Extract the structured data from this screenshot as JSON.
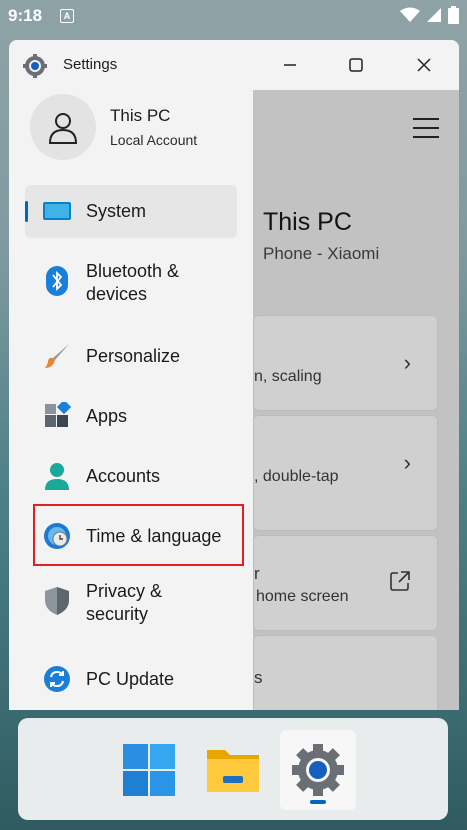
{
  "status_bar": {
    "time": "9:18",
    "badge": "A"
  },
  "window": {
    "title": "Settings"
  },
  "profile": {
    "name": "This PC",
    "account_type": "Local Account"
  },
  "nav": {
    "items": [
      {
        "label": "System",
        "icon": "monitor-icon"
      },
      {
        "label1": "Bluetooth &",
        "label2": "devices",
        "icon": "bluetooth-icon"
      },
      {
        "label": "Personalize",
        "icon": "paintbrush-icon"
      },
      {
        "label": "Apps",
        "icon": "apps-icon"
      },
      {
        "label": "Accounts",
        "icon": "person-icon"
      },
      {
        "label": "Time & language",
        "icon": "globe-clock-icon"
      },
      {
        "label1": "Privacy &",
        "label2": "security",
        "icon": "shield-icon"
      },
      {
        "label": "PC Update",
        "icon": "sync-icon"
      }
    ],
    "active_index": 0,
    "highlighted_index": 5
  },
  "content": {
    "device_name": "This PC",
    "device_subtitle": "Phone - Xiaomi",
    "cards": [
      {
        "text": "n, scaling"
      },
      {
        "text": ", double-tap"
      },
      {
        "line1": "r",
        "line2": "home screen"
      },
      {
        "text": "s"
      }
    ]
  },
  "colors": {
    "accent": "#0067c0",
    "highlight_border": "#e02020"
  },
  "taskbar": {
    "apps": [
      "start-icon",
      "file-explorer-icon",
      "settings-icon"
    ],
    "active": "settings-icon"
  }
}
